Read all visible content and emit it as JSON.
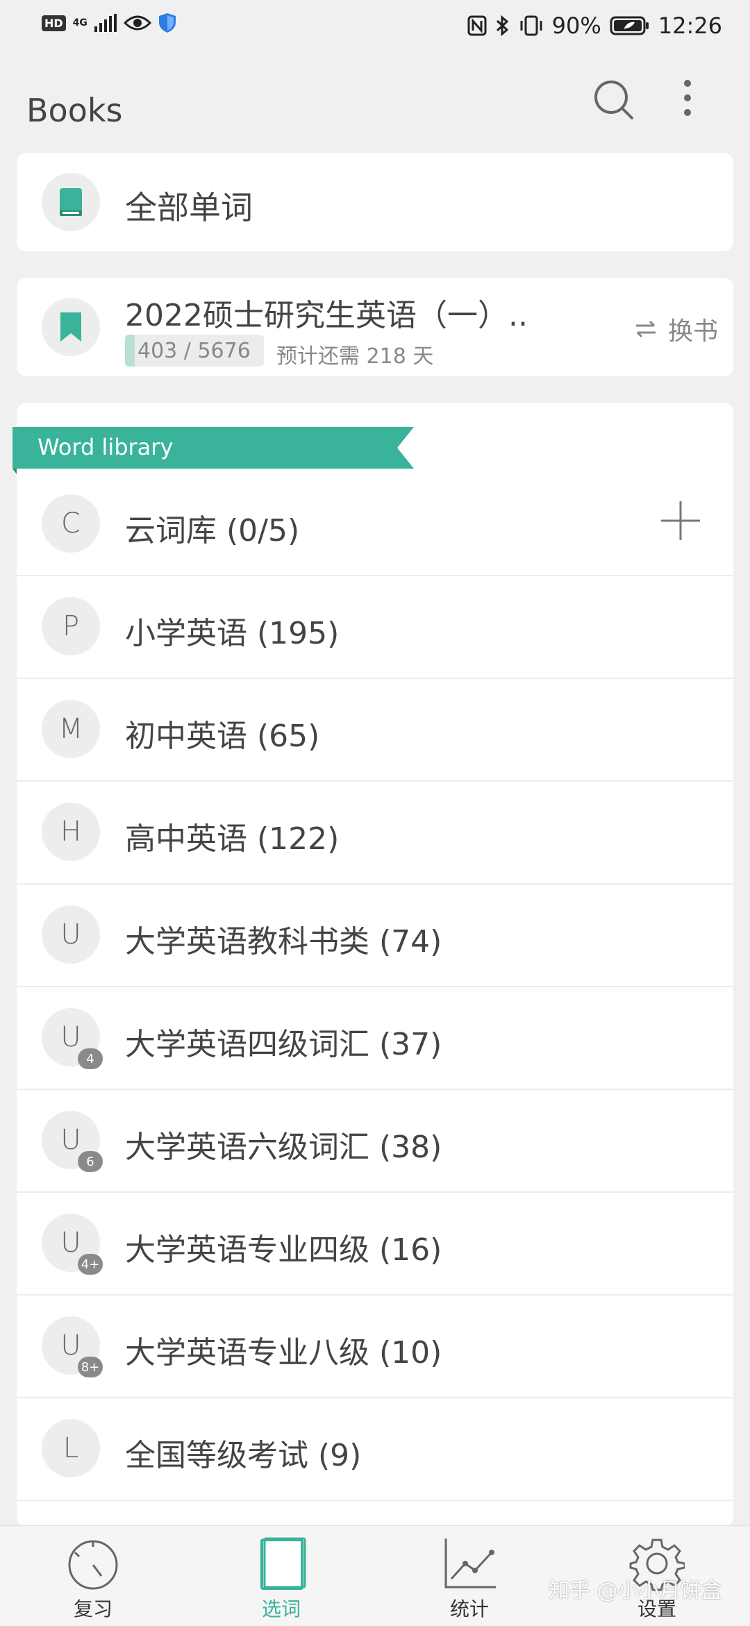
{
  "status_bar": {
    "network": "4G",
    "battery": "90%",
    "time": "12:26"
  },
  "header": {
    "title": "Books"
  },
  "all_words": {
    "label": "全部单词"
  },
  "current_book": {
    "name": "2022硕士研究生英语（一）..",
    "progress_text": "403 / 5676",
    "progress_learned": 403,
    "progress_total": 5676,
    "remaining": "预计还需 218 天",
    "switch_label": "换书"
  },
  "library": {
    "ribbon_label": "Word library",
    "items": [
      {
        "letter": "C",
        "sub": "",
        "label": "云词库 (0/5)",
        "has_add": true
      },
      {
        "letter": "P",
        "sub": "",
        "label": "小学英语 (195)"
      },
      {
        "letter": "M",
        "sub": "",
        "label": "初中英语 (65)"
      },
      {
        "letter": "H",
        "sub": "",
        "label": "高中英语 (122)"
      },
      {
        "letter": "U",
        "sub": "",
        "label": "大学英语教科书类 (74)"
      },
      {
        "letter": "U",
        "sub": "4",
        "label": "大学英语四级词汇 (37)"
      },
      {
        "letter": "U",
        "sub": "6",
        "label": "大学英语六级词汇 (38)"
      },
      {
        "letter": "U",
        "sub": "4+",
        "label": "大学英语专业四级 (16)"
      },
      {
        "letter": "U",
        "sub": "8+",
        "label": "大学英语专业八级 (10)"
      },
      {
        "letter": "L",
        "sub": "",
        "label": "全国等级考试 (9)"
      }
    ]
  },
  "bottom_nav": {
    "items": [
      {
        "label": "复习",
        "icon": "dial-icon",
        "active": false
      },
      {
        "label": "选词",
        "icon": "book-icon",
        "active": true
      },
      {
        "label": "统计",
        "icon": "chart-icon",
        "active": false
      },
      {
        "label": "设置",
        "icon": "gear-icon",
        "active": false
      }
    ]
  },
  "watermark": "知乎 @小小月饼盒",
  "colors": {
    "accent": "#39b39a",
    "background": "#f0f0f0",
    "card": "#ffffff"
  }
}
